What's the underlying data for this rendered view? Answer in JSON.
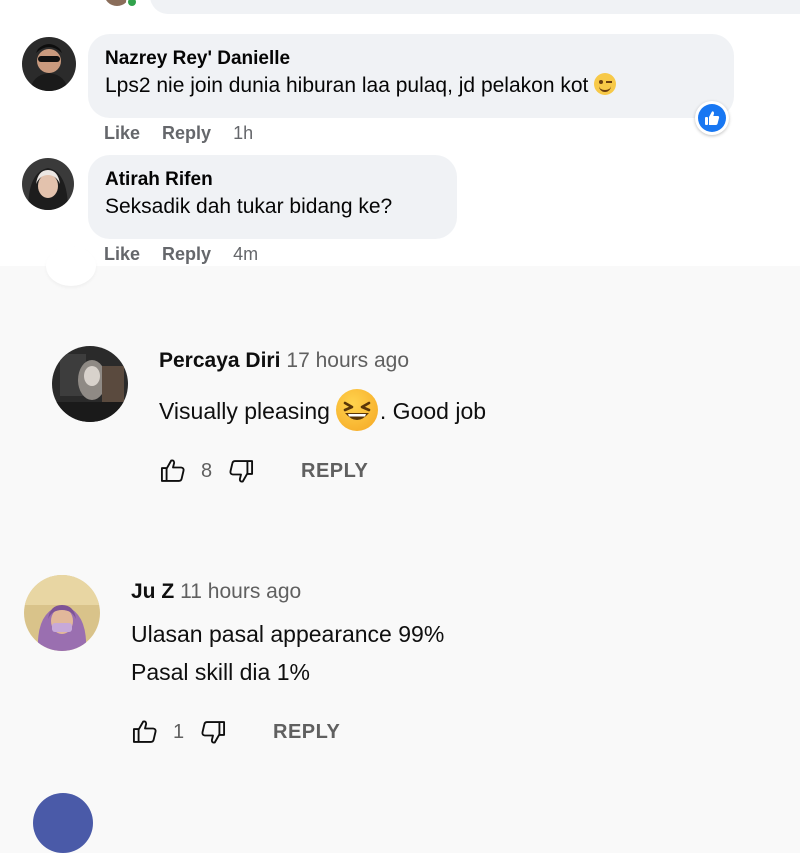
{
  "facebook": {
    "comments": [
      {
        "name": "Nazrey Rey' Danielle",
        "text": "Lps2 nie join dunia hiburan laa pulaq, jd pelakon kot",
        "like": "Like",
        "reply": "Reply",
        "time": "1h",
        "emoji": "winking-face-emoji",
        "reaction": "like-reaction"
      },
      {
        "name": "Atirah Rifen",
        "text": "Seksadik dah tukar bidang ke?",
        "like": "Like",
        "reply": "Reply",
        "time": "4m"
      }
    ],
    "colors": {
      "bubble": "#f0f2f5",
      "meta": "#65676b",
      "like_blue": "#1877f2"
    }
  },
  "youtube": {
    "comments": [
      {
        "author": "Percaya Diri",
        "time": "17 hours ago",
        "text_before": "Visually pleasing",
        "text_after": ". Good job",
        "emoji": "grinning-squinting-face-emoji",
        "likes": "8",
        "reply": "REPLY"
      },
      {
        "author": "Ju Z",
        "time": "11 hours ago",
        "lines": [
          "Ulasan pasal appearance 99%",
          "Pasal skill dia 1%"
        ],
        "likes": "1",
        "reply": "REPLY"
      }
    ],
    "colors": {
      "background": "#f9f9f9",
      "meta": "#606060",
      "text": "#0f0f0f"
    }
  }
}
